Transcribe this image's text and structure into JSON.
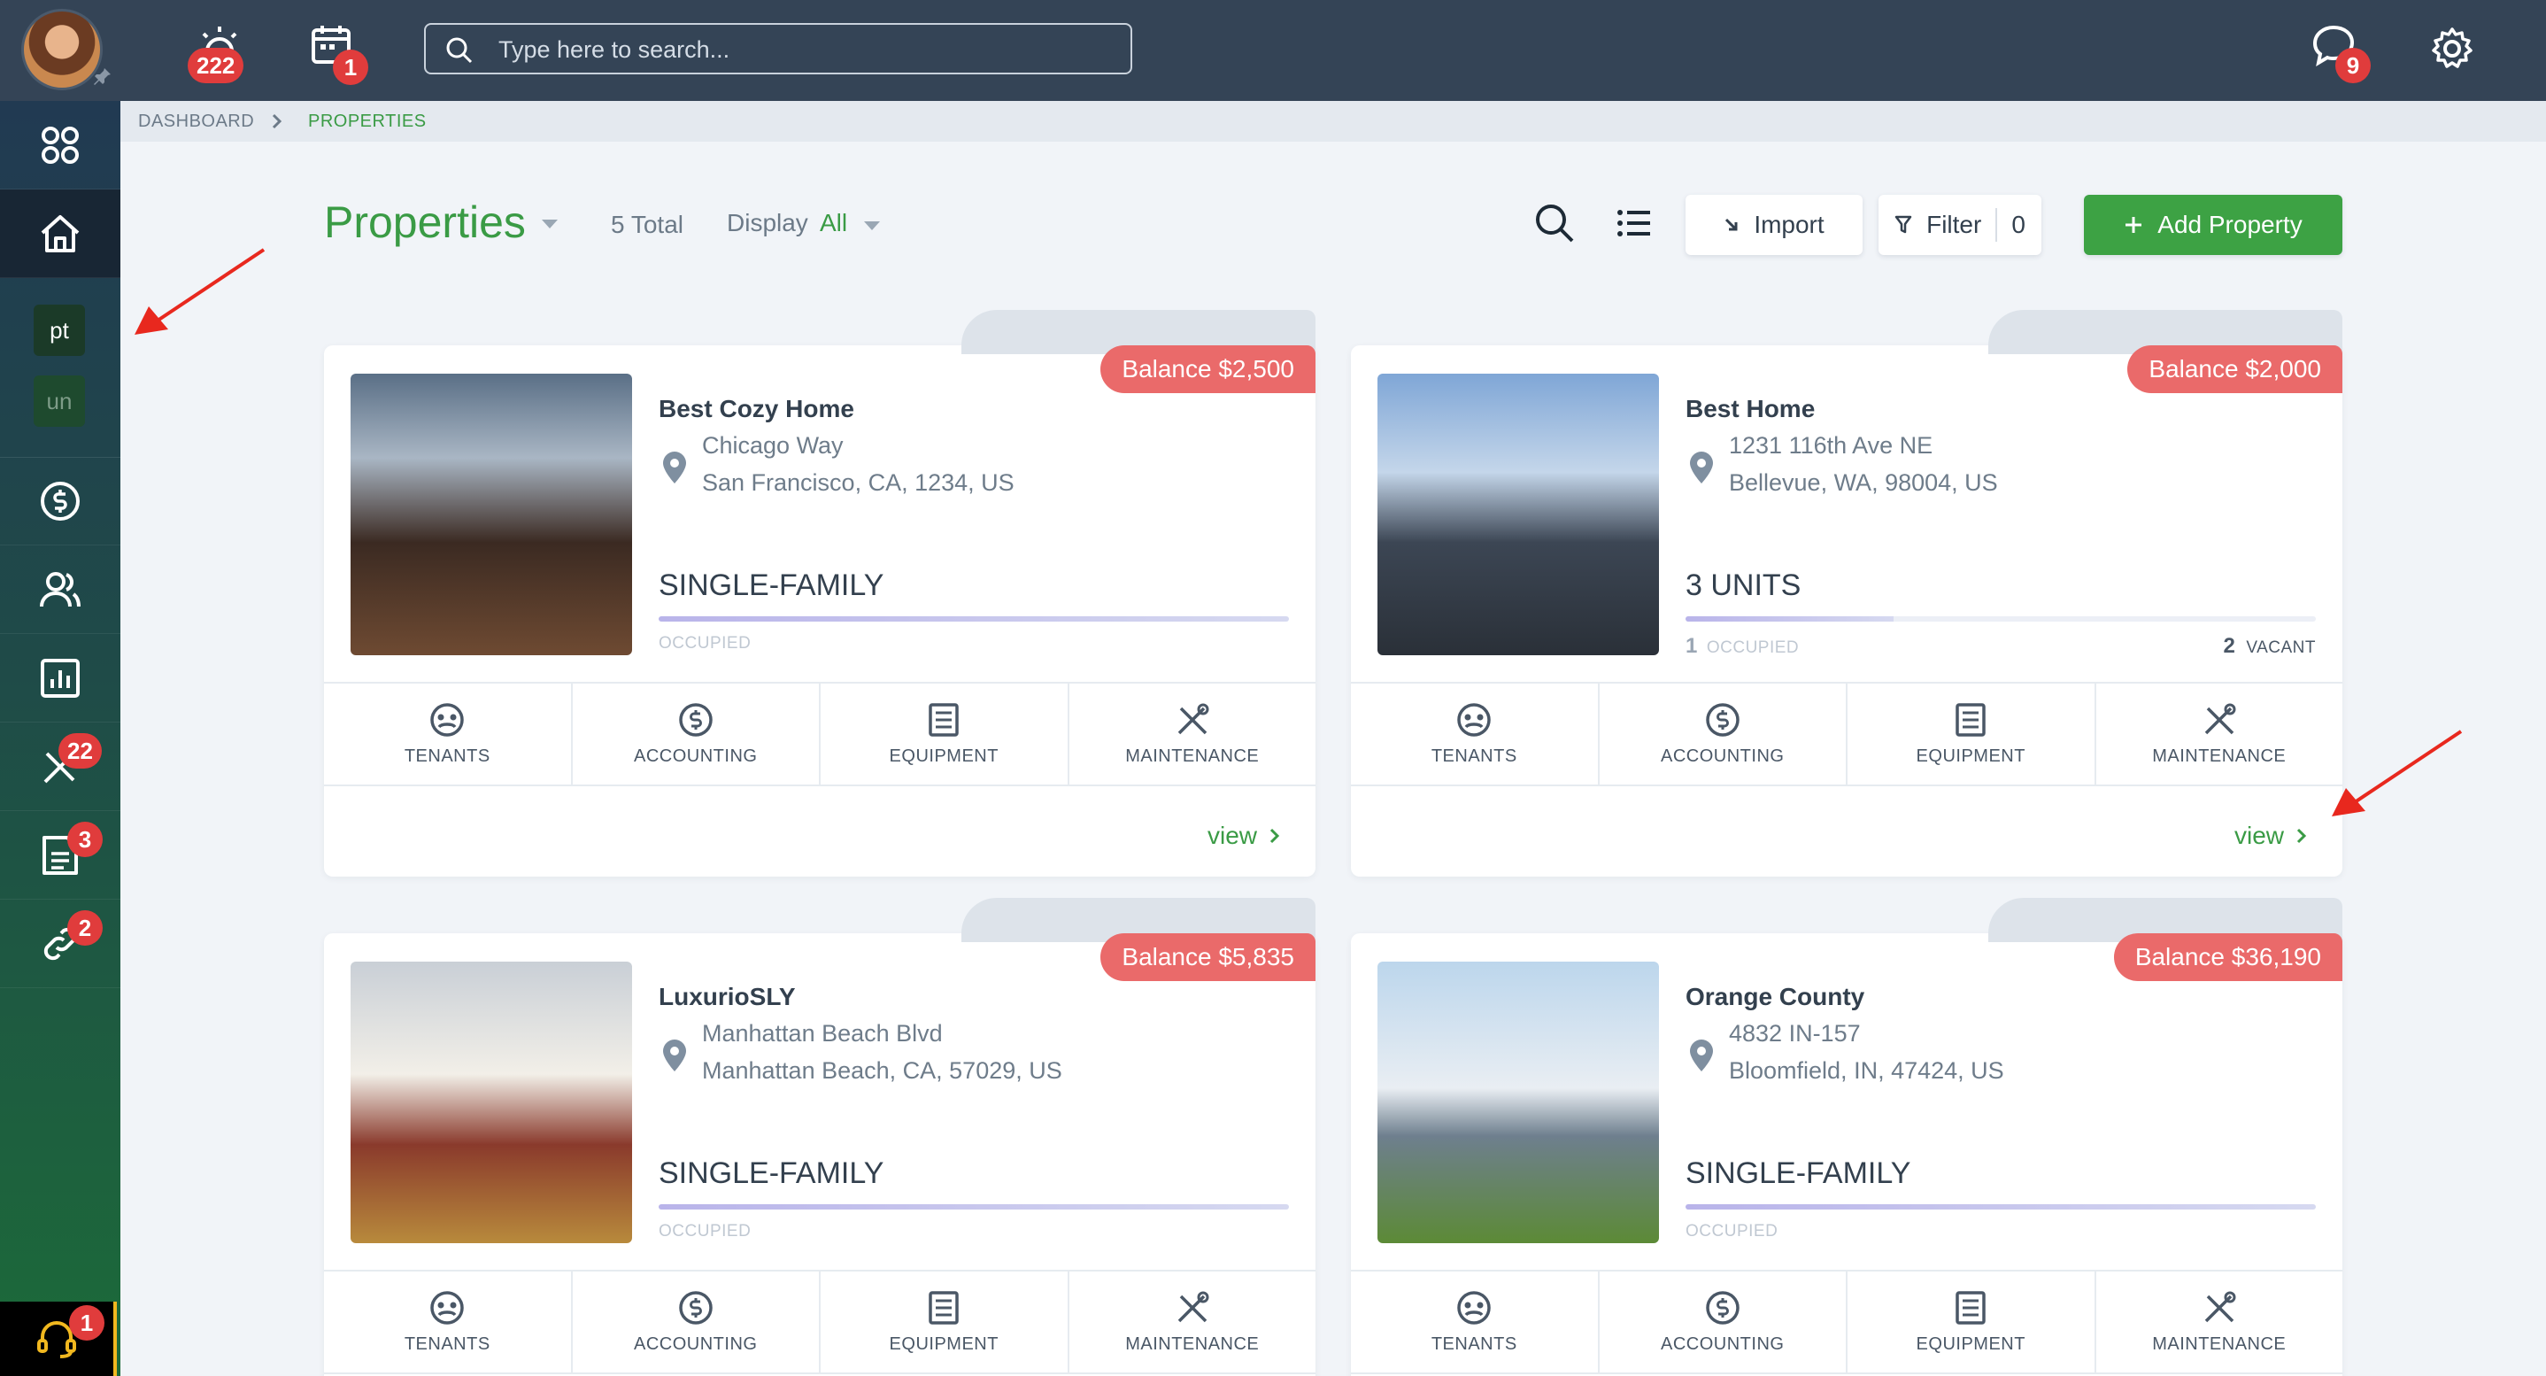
{
  "topbar": {
    "notifications_count": "222",
    "calendar_count": "1",
    "search_placeholder": "Type here to search...",
    "messages_count": "9"
  },
  "sidebar": {
    "chips": [
      "pt",
      "un"
    ],
    "maintenance_count": "22",
    "documents_count": "3",
    "links_count": "2",
    "support_count": "1"
  },
  "breadcrumb": {
    "root": "DASHBOARD",
    "current": "PROPERTIES"
  },
  "header": {
    "title": "Properties",
    "total": "5 Total",
    "display_label": "Display",
    "display_value": "All",
    "import_label": "Import",
    "filter_label": "Filter",
    "filter_count": "0",
    "add_label": "Add Property"
  },
  "card_labels": {
    "actions": [
      "TENANTS",
      "ACCOUNTING",
      "EQUIPMENT",
      "MAINTENANCE"
    ],
    "occupied": "OCCUPIED",
    "vacant": "VACANT",
    "view": "view"
  },
  "properties": [
    {
      "balance": "Balance $2,500",
      "name": "Best Cozy Home",
      "street": "Chicago Way",
      "city": "San Francisco, CA, 1234, US",
      "type": "SINGLE-FAMILY",
      "occupied": "",
      "vacant": "",
      "occupancy_fraction": 1.0
    },
    {
      "balance": "Balance $2,000",
      "name": "Best Home",
      "street": "1231 116th Ave NE",
      "city": "Bellevue, WA, 98004, US",
      "type": "3 UNITS",
      "occupied": "1",
      "vacant": "2",
      "occupancy_fraction": 0.33
    },
    {
      "balance": "Balance $5,835",
      "name": "LuxurioSLY",
      "street": "Manhattan Beach Blvd",
      "city": "Manhattan Beach, CA, 57029, US",
      "type": "SINGLE-FAMILY",
      "occupied": "",
      "vacant": "",
      "occupancy_fraction": 1.0
    },
    {
      "balance": "Balance $36,190",
      "name": "Orange County",
      "street": "4832 IN-157",
      "city": "Bloomfield, IN, 47424, US",
      "type": "SINGLE-FAMILY",
      "occupied": "",
      "vacant": "",
      "occupancy_fraction": 1.0
    }
  ],
  "colors": {
    "accent": "#3da244",
    "topbar": "#344456",
    "badge": "#e03c3c",
    "balance": "#ea6a6a",
    "annotation_arrow": "#e8281e"
  }
}
